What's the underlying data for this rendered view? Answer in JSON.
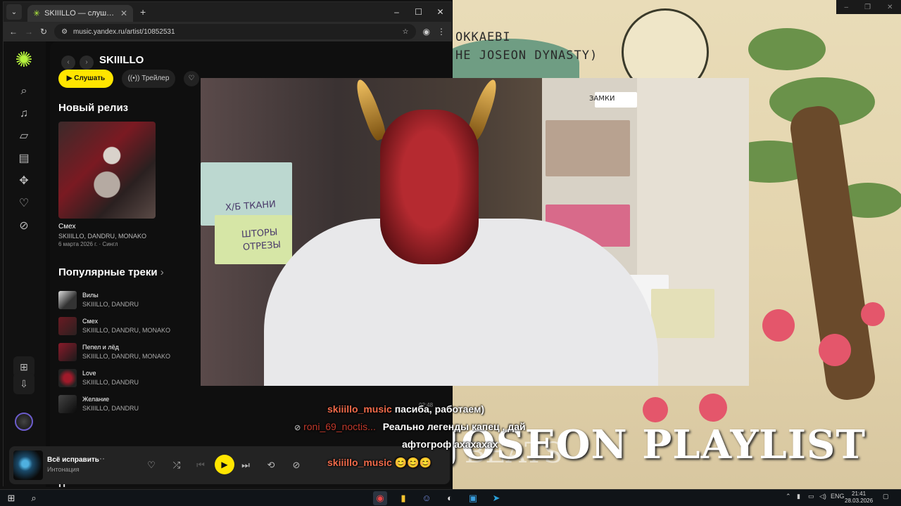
{
  "browser": {
    "tab_title": "SKIIILLO — слушать онлайн бе",
    "url": "music.yandex.ru/artist/10852531"
  },
  "artist": {
    "name": "SKIIILLO",
    "listen_label": "Слушать",
    "trailer_label": "Трейлер"
  },
  "new_release": {
    "heading": "Новый релиз",
    "title": "Смех",
    "artists": "SKIIILLO, DANDRU, MONAKO",
    "meta": "6 марта 2026 г. · Сингл"
  },
  "popular": {
    "heading": "Популярные треки",
    "tracks": [
      {
        "title": "Вилы",
        "artists": "SKIIILLO, DANDRU"
      },
      {
        "title": "Смех",
        "artists": "SKIIILLO, DANDRU, MONAKO"
      },
      {
        "title": "Пепел и лёд",
        "artists": "SKIIILLO, DANDRU, MONAKO"
      },
      {
        "title": "Love",
        "artists": "SKIIILLO, DANDRU"
      },
      {
        "title": "Желание",
        "artists": "SKIIILLO, DANDRU"
      }
    ],
    "next_heading_partial": "П"
  },
  "player": {
    "title": "Всё исправить",
    "artist": "Интонация",
    "dots": "···"
  },
  "chat": [
    {
      "name": "skiiillo_music",
      "message": "пасиба, работаем)"
    },
    {
      "name": "roni_69_noctis...",
      "message": "Реально легенды капец , дай"
    },
    {
      "name": "",
      "message": "афтогроф ахахахах"
    },
    {
      "name": "skiiillo_music",
      "message": "😊😊😊"
    }
  ],
  "chat_timestamp": "02:48",
  "background": {
    "caption_line1": "OKKAEBI",
    "caption_line2": "HE JOSEON DYNASTY)",
    "playlist_title": "JOSEON PLAYLIST",
    "beats": "BEATS"
  },
  "webcam": {
    "label_box1": "Х/Б ТКАНИ",
    "label_box2a": "ШТОРЫ",
    "label_box2b": "ОТРЕЗЫ",
    "label_shelf1": "ЗАМКИ"
  },
  "taskbar": {
    "lang": "ENG",
    "time": "21:41",
    "date": "28.03.2026"
  },
  "colors": {
    "accent": "#ffe500",
    "brand": "#b5f23d",
    "chat_name": "#f06a4a"
  }
}
